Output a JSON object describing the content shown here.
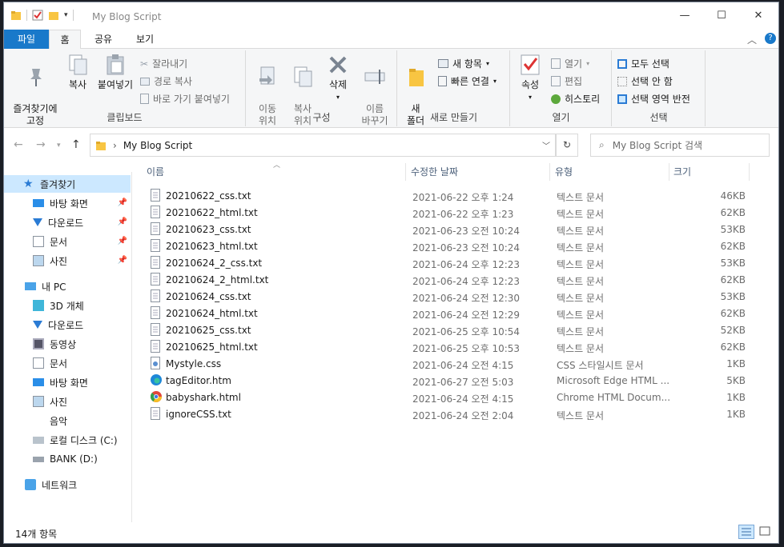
{
  "window": {
    "title": "My Blog Script"
  },
  "ribbon_tabs": {
    "file": "파일",
    "home": "홈",
    "share": "공유",
    "view": "보기"
  },
  "clipboard": {
    "pin": "즐겨찾기에\n고정",
    "copy": "복사",
    "paste": "붙여넣기",
    "cut": "잘라내기",
    "copy_path": "경로 복사",
    "paste_shortcut": "바로 가기 붙여넣기",
    "label": "클립보드"
  },
  "organize": {
    "move": "이동\n위치",
    "copyto": "복사\n위치",
    "delete": "삭제",
    "rename": "이름\n바꾸기",
    "label": "구성"
  },
  "new": {
    "folder": "새\n폴더",
    "new_item": "새 항목",
    "easy_access": "빠른 연결",
    "label": "새로 만들기"
  },
  "open": {
    "properties": "속성",
    "open": "열기",
    "edit": "편집",
    "history": "히스토리",
    "label": "열기"
  },
  "select": {
    "all": "모두 선택",
    "none": "선택 안 함",
    "invert": "선택 영역 반전",
    "label": "선택"
  },
  "address": {
    "path": "My Blog Script",
    "search_placeholder": "My Blog Script 검색"
  },
  "nav": {
    "quick_access": "즐겨찾기",
    "qa_items": [
      "바탕 화면",
      "다운로드",
      "문서",
      "사진"
    ],
    "this_pc": "내 PC",
    "pc_items": [
      "3D 개체",
      "다운로드",
      "동영상",
      "문서",
      "바탕 화면",
      "사진",
      "음악",
      "로컬 디스크 (C:)",
      "BANK (D:)"
    ],
    "network": "네트워크"
  },
  "columns": {
    "name": "이름",
    "date": "수정한 날짜",
    "type": "유형",
    "size": "크기"
  },
  "files": [
    {
      "name": "20210622_css.txt",
      "date": "2021-06-22 오후 1:24",
      "type": "텍스트 문서",
      "size": "46KB",
      "icon": "txt"
    },
    {
      "name": "20210622_html.txt",
      "date": "2021-06-22 오후 1:23",
      "type": "텍스트 문서",
      "size": "62KB",
      "icon": "txt"
    },
    {
      "name": "20210623_css.txt",
      "date": "2021-06-23 오전 10:24",
      "type": "텍스트 문서",
      "size": "53KB",
      "icon": "txt"
    },
    {
      "name": "20210623_html.txt",
      "date": "2021-06-23 오전 10:24",
      "type": "텍스트 문서",
      "size": "62KB",
      "icon": "txt"
    },
    {
      "name": "20210624_2_css.txt",
      "date": "2021-06-24 오후 12:23",
      "type": "텍스트 문서",
      "size": "53KB",
      "icon": "txt"
    },
    {
      "name": "20210624_2_html.txt",
      "date": "2021-06-24 오후 12:23",
      "type": "텍스트 문서",
      "size": "62KB",
      "icon": "txt"
    },
    {
      "name": "20210624_css.txt",
      "date": "2021-06-24 오전 12:30",
      "type": "텍스트 문서",
      "size": "53KB",
      "icon": "txt"
    },
    {
      "name": "20210624_html.txt",
      "date": "2021-06-24 오전 12:29",
      "type": "텍스트 문서",
      "size": "62KB",
      "icon": "txt"
    },
    {
      "name": "20210625_css.txt",
      "date": "2021-06-25 오후 10:54",
      "type": "텍스트 문서",
      "size": "52KB",
      "icon": "txt"
    },
    {
      "name": "20210625_html.txt",
      "date": "2021-06-25 오후 10:53",
      "type": "텍스트 문서",
      "size": "62KB",
      "icon": "txt"
    },
    {
      "name": "Mystyle.css",
      "date": "2021-06-24 오전 4:15",
      "type": "CSS 스타일시트 문서",
      "size": "1KB",
      "icon": "css"
    },
    {
      "name": "tagEditor.htm",
      "date": "2021-06-27 오전 5:03",
      "type": "Microsoft Edge HTML ...",
      "size": "5KB",
      "icon": "edge"
    },
    {
      "name": "babyshark.html",
      "date": "2021-06-24 오전 4:15",
      "type": "Chrome HTML Docum...",
      "size": "1KB",
      "icon": "chrome"
    },
    {
      "name": "ignoreCSS.txt",
      "date": "2021-06-24 오전 2:04",
      "type": "텍스트 문서",
      "size": "1KB",
      "icon": "txt"
    }
  ],
  "status": {
    "count": "14개 항목"
  },
  "colors": {
    "accent": "#1979ca",
    "selection": "#cce8ff",
    "folder": "#f8c542"
  }
}
